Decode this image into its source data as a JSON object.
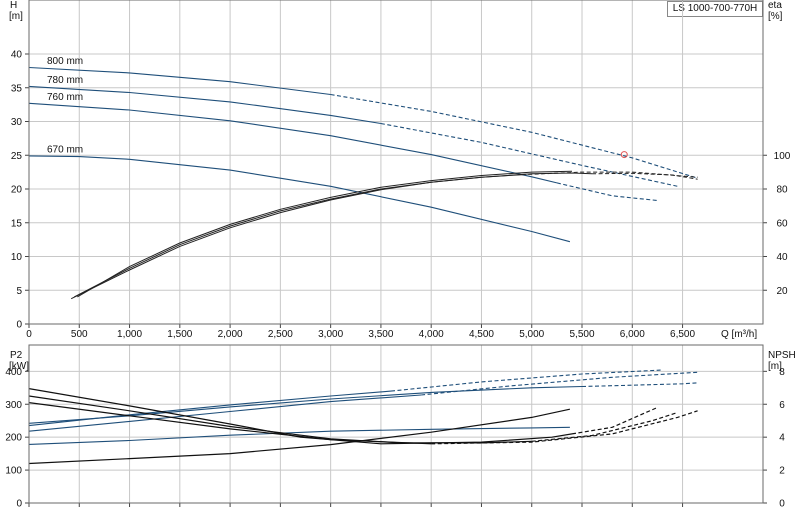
{
  "model_label": "LS 1000-700-770H",
  "chart_data": [
    {
      "type": "line",
      "panel": "QH",
      "xlabel": "Q [m³/h]",
      "x_ticks": [
        "0",
        "500",
        "1,000",
        "1,500",
        "2,000",
        "2,500",
        "3,000",
        "3,500",
        "4,000",
        "4,500",
        "5,000",
        "5,500",
        "6,000",
        "6,500"
      ],
      "xlim": [
        0,
        7300
      ],
      "y_left": {
        "name": "H",
        "unit": "[m]",
        "ticks": [
          "0",
          "5",
          "10",
          "15",
          "20",
          "25",
          "30",
          "35",
          "40"
        ],
        "ylim": [
          0,
          48
        ]
      },
      "y_right": {
        "name": "eta",
        "unit": "[%]",
        "ticks": [
          "20",
          "40",
          "60",
          "80",
          "100"
        ],
        "ylim": [
          0,
          192
        ]
      },
      "grid": true,
      "duty_point": {
        "q": 5920,
        "h": 25.1
      },
      "head_curves": [
        {
          "label": "800 mm",
          "solid": [
            [
              0,
              38.0
            ],
            [
              1000,
              37.2
            ],
            [
              2000,
              35.9
            ],
            [
              3000,
              34.0
            ]
          ],
          "dashed": [
            [
              3000,
              34.0
            ],
            [
              4000,
              31.5
            ],
            [
              5000,
              28.4
            ],
            [
              6000,
              24.6
            ],
            [
              6650,
              21.6
            ]
          ]
        },
        {
          "label": "780 mm",
          "solid": [
            [
              0,
              35.2
            ],
            [
              1000,
              34.3
            ],
            [
              2000,
              32.9
            ],
            [
              3000,
              30.9
            ],
            [
              3500,
              29.7
            ]
          ],
          "dashed": [
            [
              3500,
              29.7
            ],
            [
              4500,
              26.9
            ],
            [
              5500,
              23.5
            ],
            [
              6450,
              20.4
            ]
          ]
        },
        {
          "label": "760 mm",
          "solid": [
            [
              0,
              32.7
            ],
            [
              1000,
              31.7
            ],
            [
              2000,
              30.1
            ],
            [
              3000,
              27.9
            ],
            [
              4000,
              25.1
            ],
            [
              5000,
              21.8
            ],
            [
              5250,
              20.9
            ]
          ],
          "dashed": [
            [
              5250,
              20.9
            ],
            [
              5800,
              19.0
            ],
            [
              6250,
              18.3
            ]
          ]
        },
        {
          "label": "670 mm",
          "solid": [
            [
              0,
              24.9
            ],
            [
              500,
              24.8
            ],
            [
              1000,
              24.4
            ],
            [
              2000,
              22.8
            ],
            [
              3000,
              20.4
            ],
            [
              4000,
              17.3
            ],
            [
              5000,
              13.7
            ],
            [
              5380,
              12.2
            ]
          ],
          "dashed": []
        }
      ],
      "efficiency_curves": [
        {
          "solid": [
            [
              480,
              16
            ],
            [
              1000,
              34
            ],
            [
              1500,
              48
            ],
            [
              2000,
              59
            ],
            [
              2500,
              68
            ],
            [
              3000,
              75
            ],
            [
              3500,
              81
            ],
            [
              4000,
              85
            ],
            [
              4500,
              88
            ],
            [
              5000,
              90
            ],
            [
              5400,
              90.5
            ]
          ],
          "dashed": []
        },
        {
          "solid": [
            [
              450,
              16
            ],
            [
              1000,
              33
            ],
            [
              1500,
              47
            ],
            [
              2000,
              58
            ],
            [
              2500,
              67
            ],
            [
              3000,
              74
            ],
            [
              3500,
              80
            ],
            [
              4000,
              84
            ],
            [
              4500,
              87
            ],
            [
              5000,
              89
            ],
            [
              5400,
              89.5
            ],
            [
              5600,
              89
            ]
          ],
          "dashed": [
            [
              5600,
              89
            ],
            [
              6000,
              89.3
            ],
            [
              6400,
              88.3
            ],
            [
              6650,
              85.8
            ]
          ]
        },
        {
          "solid": [
            [
              420,
              15
            ],
            [
              1000,
              32
            ],
            [
              1500,
              46
            ],
            [
              2000,
              57
            ],
            [
              2500,
              66
            ],
            [
              3000,
              73.5
            ],
            [
              3500,
              79.5
            ],
            [
              4000,
              84
            ],
            [
              4500,
              87
            ],
            [
              4900,
              88.5
            ]
          ],
          "dashed": [
            [
              4900,
              88.5
            ],
            [
              5500,
              90
            ],
            [
              6000,
              90
            ],
            [
              6650,
              87
            ]
          ]
        }
      ]
    },
    {
      "type": "line",
      "panel": "P2-NPSH",
      "x_ticks": [
        "0",
        "500",
        "1,000",
        "1,500",
        "2,000",
        "2,500",
        "3,000",
        "3,500",
        "4,000",
        "4,500",
        "5,000",
        "5,500",
        "6,000",
        "6,500"
      ],
      "xlim": [
        0,
        7300
      ],
      "y_left": {
        "name": "P2",
        "unit": "[kW]",
        "ticks": [
          "0",
          "100",
          "200",
          "300",
          "400"
        ],
        "ylim": [
          0,
          480
        ]
      },
      "y_right": {
        "name": "NPSH",
        "unit": "[m]",
        "ticks": [
          "0",
          "2",
          "4",
          "6",
          "8"
        ],
        "ylim": [
          0,
          9.6
        ]
      },
      "grid": true,
      "power_curves": [
        {
          "solid": [
            [
              0,
              235
            ],
            [
              1000,
              268
            ],
            [
              2000,
              298
            ],
            [
              3000,
              325
            ],
            [
              3600,
              340
            ]
          ],
          "dashed": [
            [
              3600,
              340
            ],
            [
              4500,
              368
            ],
            [
              5500,
              392
            ],
            [
              6300,
              404
            ]
          ]
        },
        {
          "solid": [
            [
              0,
              218
            ],
            [
              1000,
              248
            ],
            [
              2000,
              278
            ],
            [
              3000,
              308
            ],
            [
              3900,
              328
            ]
          ],
          "dashed": [
            [
              3900,
              328
            ],
            [
              4800,
              356
            ],
            [
              5800,
              382
            ],
            [
              6650,
              397
            ]
          ]
        },
        {
          "solid": [
            [
              0,
              242
            ],
            [
              1000,
              265
            ],
            [
              2000,
              292
            ],
            [
              3000,
              316
            ],
            [
              4000,
              336
            ],
            [
              5000,
              350
            ],
            [
              5500,
              354
            ]
          ],
          "dashed": [
            [
              5500,
              354
            ],
            [
              6000,
              358
            ],
            [
              6500,
              362
            ],
            [
              6650,
              365
            ]
          ]
        },
        {
          "solid": [
            [
              0,
              178
            ],
            [
              1000,
              190
            ],
            [
              2000,
              206
            ],
            [
              3000,
              218
            ],
            [
              4000,
              224
            ],
            [
              5000,
              228
            ],
            [
              5380,
              230
            ]
          ],
          "dashed": []
        }
      ],
      "npsh_curves": [
        {
          "solid": [
            [
              0,
              2.4
            ],
            [
              1000,
              2.7
            ],
            [
              2000,
              3.0
            ],
            [
              3000,
              3.55
            ],
            [
              4000,
              4.3
            ],
            [
              5000,
              5.2
            ],
            [
              5380,
              5.7
            ]
          ],
          "dashed": []
        },
        {
          "solid": [
            [
              0,
              6.95
            ],
            [
              1000,
              5.9
            ],
            [
              2000,
              4.8
            ],
            [
              2700,
              4.0
            ],
            [
              3500,
              3.6
            ],
            [
              4500,
              3.7
            ],
            [
              5200,
              4.0
            ],
            [
              5400,
              4.2
            ]
          ],
          "dashed": [
            [
              5400,
              4.2
            ],
            [
              5800,
              4.6
            ],
            [
              6250,
              5.8
            ]
          ]
        },
        {
          "solid": [
            [
              0,
              6.5
            ],
            [
              1000,
              5.6
            ],
            [
              2000,
              4.65
            ],
            [
              3000,
              3.9
            ],
            [
              3700,
              3.65
            ],
            [
              4500,
              3.65
            ],
            [
              5000,
              3.75
            ]
          ],
          "dashed": [
            [
              5000,
              3.75
            ],
            [
              5600,
              4.1
            ],
            [
              6200,
              5.0
            ],
            [
              6450,
              5.5
            ]
          ]
        },
        {
          "solid": [
            [
              0,
              6.1
            ],
            [
              1000,
              5.3
            ],
            [
              2000,
              4.5
            ],
            [
              3000,
              3.85
            ],
            [
              4000,
              3.6
            ]
          ],
          "dashed": [
            [
              4000,
              3.6
            ],
            [
              5000,
              3.7
            ],
            [
              5800,
              4.2
            ],
            [
              6450,
              5.2
            ],
            [
              6650,
              5.6
            ]
          ]
        }
      ]
    }
  ]
}
